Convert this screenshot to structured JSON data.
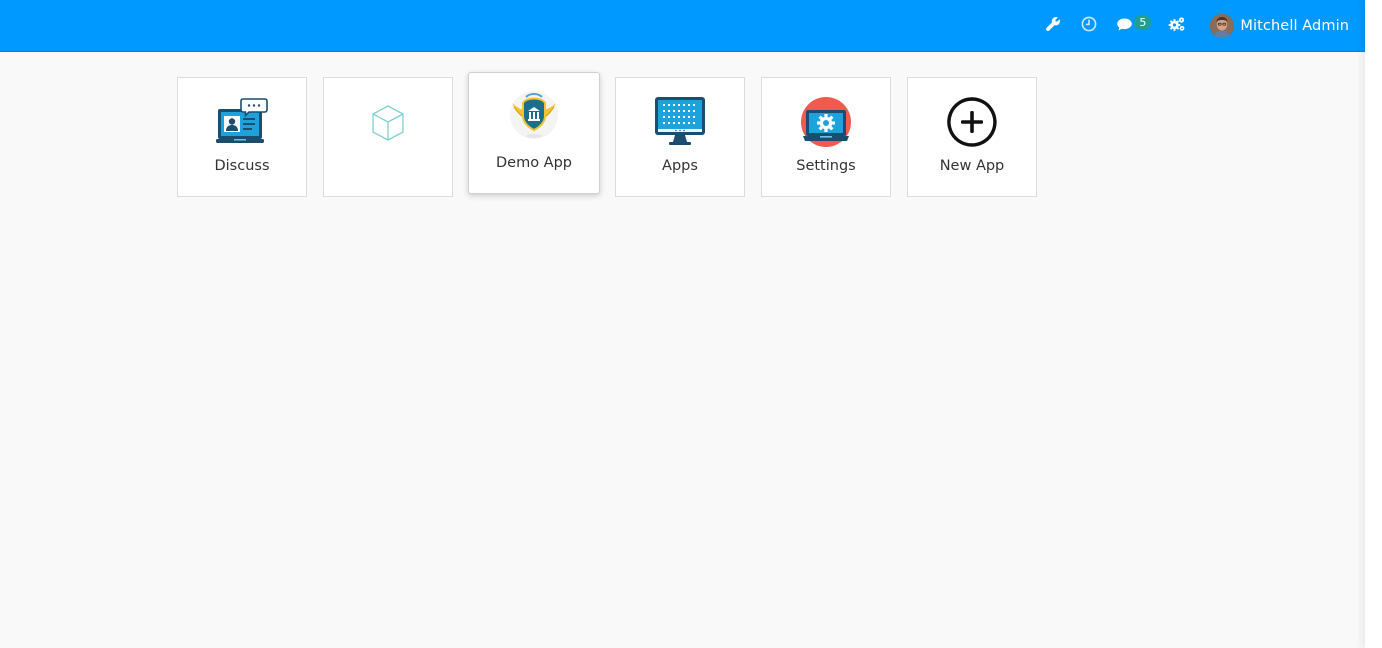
{
  "navbar": {
    "background": "#0099ff",
    "systray": {
      "debug_icon": "wrench-icon",
      "activity_icon": "clock-icon",
      "messaging_icon": "chat-icon",
      "messaging_count": "5",
      "company_icon": "gears-icon"
    },
    "user": {
      "name": "Mitchell Admin",
      "avatar_icon": "avatar"
    }
  },
  "apps": [
    {
      "label": "Discuss",
      "icon": "discuss-icon"
    },
    {
      "label": "",
      "icon": "cube-icon"
    },
    {
      "label": "Demo App",
      "icon": "demo-app-emblem-icon"
    },
    {
      "label": "Apps",
      "icon": "apps-monitor-icon"
    },
    {
      "label": "Settings",
      "icon": "settings-laptop-icon"
    },
    {
      "label": "New App",
      "icon": "plus-circle-icon"
    }
  ],
  "colors": {
    "accent": "#0099ff",
    "badge": "#1f9e91",
    "page_background": "#f9f9f9",
    "tile_border": "#dcdcdc",
    "text": "#333333"
  }
}
